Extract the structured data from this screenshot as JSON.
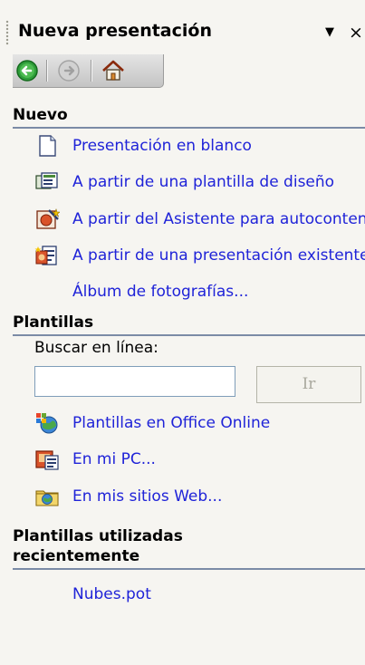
{
  "pane": {
    "title": "Nueva presentación",
    "menu_icon": "▼",
    "close_icon": "×"
  },
  "nav": {
    "back": "back-icon",
    "forward": "forward-icon",
    "home": "home-icon"
  },
  "nuevo": {
    "heading": "Nuevo",
    "items": [
      {
        "label": "Presentación en blanco",
        "icon": "blank-document-icon"
      },
      {
        "label": "A partir de una plantilla de diseño",
        "icon": "design-template-icon"
      },
      {
        "label": "A partir del Asistente para autocontenido",
        "icon": "autocontent-wizard-icon"
      },
      {
        "label": "A partir de una presentación existente",
        "icon": "existing-presentation-icon"
      },
      {
        "label": "Álbum de fotografías...",
        "icon": ""
      }
    ]
  },
  "plantillas": {
    "heading": "Plantillas",
    "search_label": "Buscar en línea:",
    "search_value": "",
    "go_label": "Ir",
    "items": [
      {
        "label": "Plantillas en Office Online",
        "icon": "office-online-icon"
      },
      {
        "label": "En mi PC...",
        "icon": "my-computer-templates-icon"
      },
      {
        "label": "En mis sitios Web...",
        "icon": "web-folder-icon"
      }
    ]
  },
  "recientes": {
    "heading_line1": "Plantillas utilizadas",
    "heading_line2": "recientemente",
    "items": [
      {
        "label": "Nubes.pot"
      }
    ]
  },
  "colors": {
    "link": "#1f23d8",
    "section_rule": "#7b8ba6",
    "pane_bg": "#f6f5f1"
  }
}
